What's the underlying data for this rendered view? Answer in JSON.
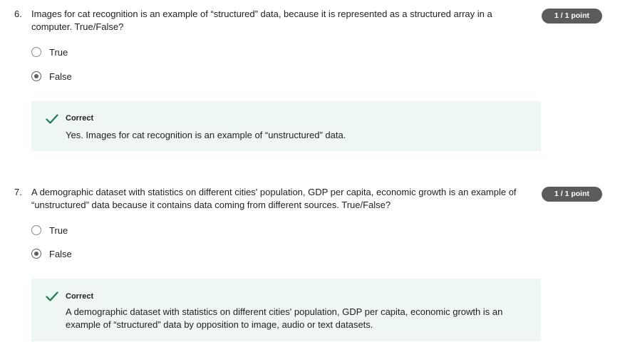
{
  "questions": [
    {
      "number": "6.",
      "text": "Images for cat recognition is an example of “structured” data, because it is represented as a structured array in a computer. True/False?",
      "points": "1 / 1 point",
      "options": [
        {
          "label": "True",
          "selected": false
        },
        {
          "label": "False",
          "selected": true
        }
      ],
      "feedback": {
        "icon": "check-icon",
        "title": "Correct",
        "text": "Yes. Images for cat recognition is an example of “unstructured” data."
      }
    },
    {
      "number": "7.",
      "text": "A demographic dataset with statistics on different cities' population, GDP per capita, economic growth is an example of “unstructured” data because it contains data coming from different sources. True/False?",
      "points": "1 / 1 point",
      "options": [
        {
          "label": "True",
          "selected": false
        },
        {
          "label": "False",
          "selected": true
        }
      ],
      "feedback": {
        "icon": "check-icon",
        "title": "Correct",
        "text": "A demographic dataset with statistics on different cities' population, GDP per capita, economic growth is an example of “structured” data by opposition to image, audio or text datasets."
      }
    }
  ],
  "colors": {
    "badge": "#5b5b5b",
    "feedback_bg": "#eef7f3",
    "check": "#1e7a4f"
  }
}
